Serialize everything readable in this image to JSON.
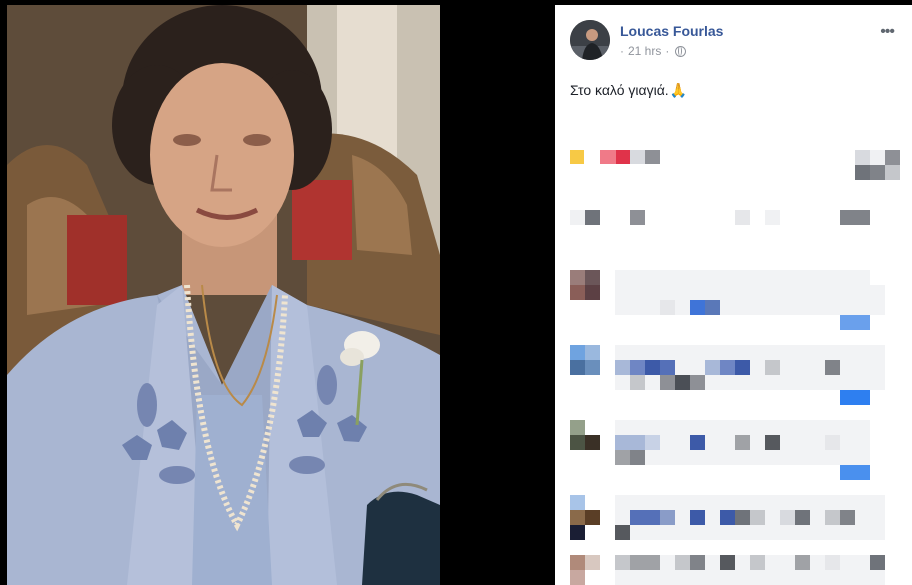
{
  "post": {
    "author": "Loucas Fourlas",
    "time": "21 hrs",
    "privacy_icon": "globe-icon",
    "more_icon": "more-options-icon",
    "more_label": "•••",
    "caption": "Στο καλό γιαγιά.",
    "caption_emoji": "🙏"
  },
  "colors": {
    "link": "#385898",
    "meta": "#90949c",
    "text": "#1d2129",
    "panel_bg": "#ffffff",
    "backdrop": "#000000"
  }
}
